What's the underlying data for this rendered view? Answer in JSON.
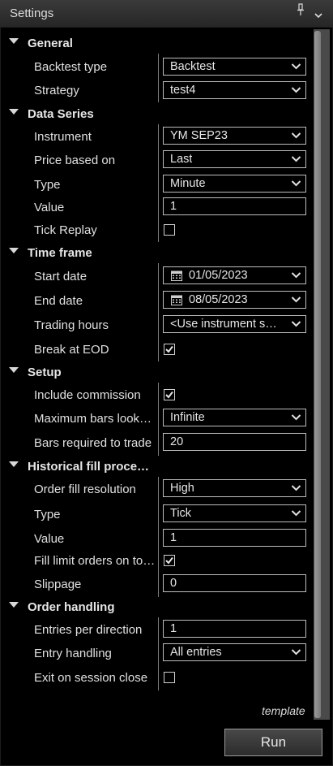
{
  "window": {
    "title": "Settings"
  },
  "sections": {
    "general": {
      "title": "General",
      "backtest_type": {
        "label": "Backtest type",
        "value": "Backtest"
      },
      "strategy": {
        "label": "Strategy",
        "value": "test4"
      }
    },
    "data_series": {
      "title": "Data Series",
      "instrument": {
        "label": "Instrument",
        "value": "YM SEP23"
      },
      "price_based_on": {
        "label": "Price based on",
        "value": "Last"
      },
      "type": {
        "label": "Type",
        "value": "Minute"
      },
      "value": {
        "label": "Value",
        "value": "1"
      },
      "tick_replay": {
        "label": "Tick Replay",
        "checked": false
      }
    },
    "time_frame": {
      "title": "Time frame",
      "start_date": {
        "label": "Start date",
        "value": "01/05/2023"
      },
      "end_date": {
        "label": "End date",
        "value": "08/05/2023"
      },
      "trading_hours": {
        "label": "Trading hours",
        "value": "<Use instrument s…"
      },
      "break_at_eod": {
        "label": "Break at EOD",
        "checked": true
      }
    },
    "setup": {
      "title": "Setup",
      "include_commission": {
        "label": "Include commission",
        "checked": true
      },
      "max_bars_lookback": {
        "label": "Maximum bars look…",
        "value": "Infinite"
      },
      "bars_required": {
        "label": "Bars required to trade",
        "value": "20"
      }
    },
    "historical_fill": {
      "title": "Historical fill proce…",
      "order_fill_resolution": {
        "label": "Order fill resolution",
        "value": "High"
      },
      "type": {
        "label": "Type",
        "value": "Tick"
      },
      "value": {
        "label": "Value",
        "value": "1"
      },
      "fill_limit_orders": {
        "label": "Fill limit orders on to…",
        "checked": true
      },
      "slippage": {
        "label": "Slippage",
        "value": "0"
      }
    },
    "order_handling": {
      "title": "Order handling",
      "entries_per_direction": {
        "label": "Entries per direction",
        "value": "1"
      },
      "entry_handling": {
        "label": "Entry handling",
        "value": "All entries"
      },
      "exit_on_session_close": {
        "label": "Exit on session close",
        "checked": false
      }
    }
  },
  "footer": {
    "template_link": "template",
    "run_label": "Run"
  },
  "icons": {
    "pin": "pin-icon",
    "dropdown": "chevron-down-icon",
    "calendar": "calendar-icon",
    "check": "check-icon",
    "collapse": "triangle-down-icon"
  }
}
